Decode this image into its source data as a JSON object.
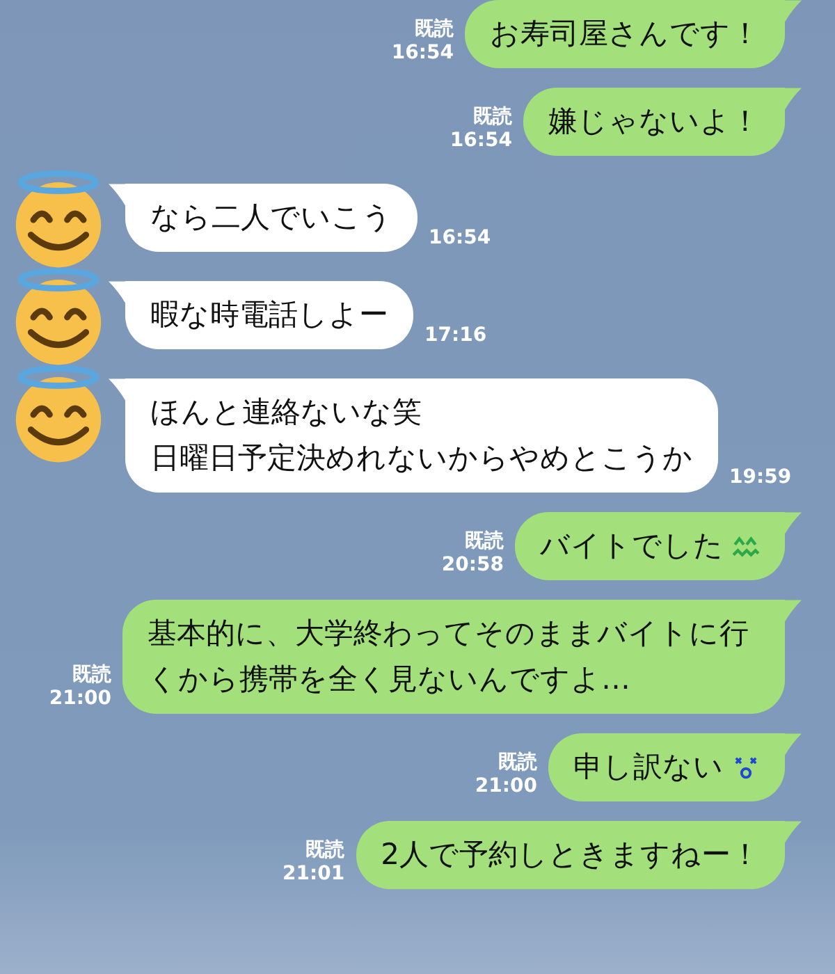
{
  "messages": [
    {
      "kind": "sent",
      "lines": [
        "お寿司屋さんです！"
      ],
      "read": "既読",
      "time": "16:54"
    },
    {
      "kind": "sent",
      "lines": [
        "嫌じゃないよ！"
      ],
      "read": "既読",
      "time": "16:54"
    },
    {
      "kind": "received",
      "lines": [
        "なら二人でいこう"
      ],
      "time": "16:54"
    },
    {
      "kind": "received",
      "lines": [
        "暇な時電話しよー"
      ],
      "time": "17:16"
    },
    {
      "kind": "received",
      "lines": [
        "ほんと連絡ないな笑",
        "日曜日予定決めれないからやめとこうか"
      ],
      "time": "19:59"
    },
    {
      "kind": "sent",
      "lines": [
        "バイトでした"
      ],
      "emoji": {
        "kind": "wavy"
      },
      "read": "既読",
      "time": "20:58"
    },
    {
      "kind": "sent",
      "lines": [
        "基本的に、大学終わってそのままバイトに行くから携帯を全く見ないんですよ…"
      ],
      "read": "既読",
      "time": "21:00"
    },
    {
      "kind": "sent",
      "lines": [
        "申し訳ない"
      ],
      "emoji": {
        "kind": "dizzy"
      },
      "read": "既読",
      "time": "21:00"
    },
    {
      "kind": "sent",
      "lines": [
        "2人で予約しときますねー！"
      ],
      "read": "既読",
      "time": "21:01"
    }
  ]
}
